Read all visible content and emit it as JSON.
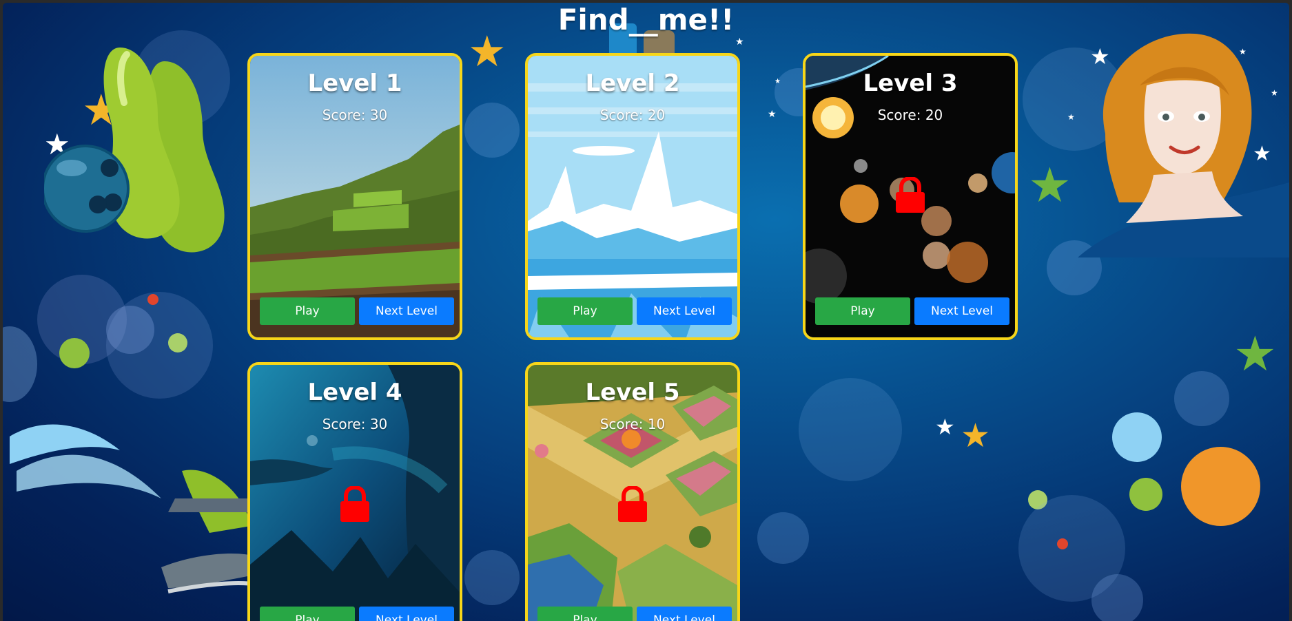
{
  "page": {
    "title": "Find__me!!"
  },
  "levels": [
    {
      "title": "Level 1",
      "score": "Score: 30",
      "play_label": "Play",
      "next_label": "Next Level",
      "locked": false,
      "theme": "voxel-hills"
    },
    {
      "title": "Level 2",
      "score": "Score: 20",
      "play_label": "Play",
      "next_label": "Next Level",
      "locked": false,
      "theme": "ice-mountains"
    },
    {
      "title": "Level 3",
      "score": "Score: 20",
      "play_label": "Play",
      "next_label": "Next Level",
      "locked": true,
      "theme": "space-planets"
    },
    {
      "title": "Level 4",
      "score": "Score: 30",
      "play_label": "Play",
      "next_label": "Next Level",
      "locked": true,
      "theme": "underwater"
    },
    {
      "title": "Level 5",
      "score": "Score: 10",
      "play_label": "Play",
      "next_label": "Next Level",
      "locked": true,
      "theme": "garden"
    }
  ],
  "colors": {
    "card_border": "#f7d619",
    "play_button": "#28a745",
    "next_button": "#0a7bff",
    "lock": "#ff0000",
    "background": "#053a78"
  },
  "icons": {
    "lock": "lock-icon",
    "decorations": [
      "bowling-pins",
      "bowling-ball",
      "girl-face",
      "airplane",
      "stars",
      "bubbles"
    ]
  }
}
